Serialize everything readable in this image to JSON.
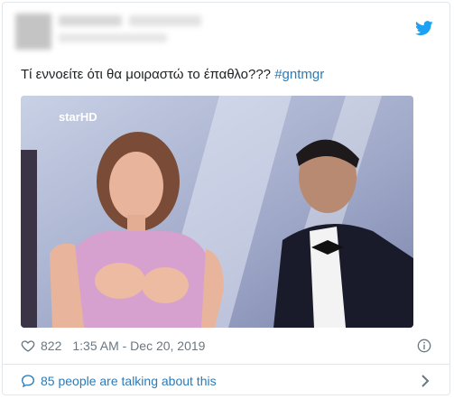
{
  "tweet": {
    "text": "Τί εννοείτε ότι θα μοιραστώ το έπαθλο???",
    "hashtag": "#gntmgr",
    "media_watermark": "starHD",
    "likes": "822",
    "timestamp": "1:35 AM - Dec 20, 2019"
  },
  "footer": {
    "talking_label": "85 people are talking about this"
  },
  "colors": {
    "link": "#2b7bb9",
    "meta": "#697882",
    "twitter_brand": "#1da1f2"
  },
  "icons": [
    "twitter-bird-icon",
    "heart-icon",
    "info-icon",
    "speech-bubble-icon",
    "chevron-right-icon"
  ]
}
